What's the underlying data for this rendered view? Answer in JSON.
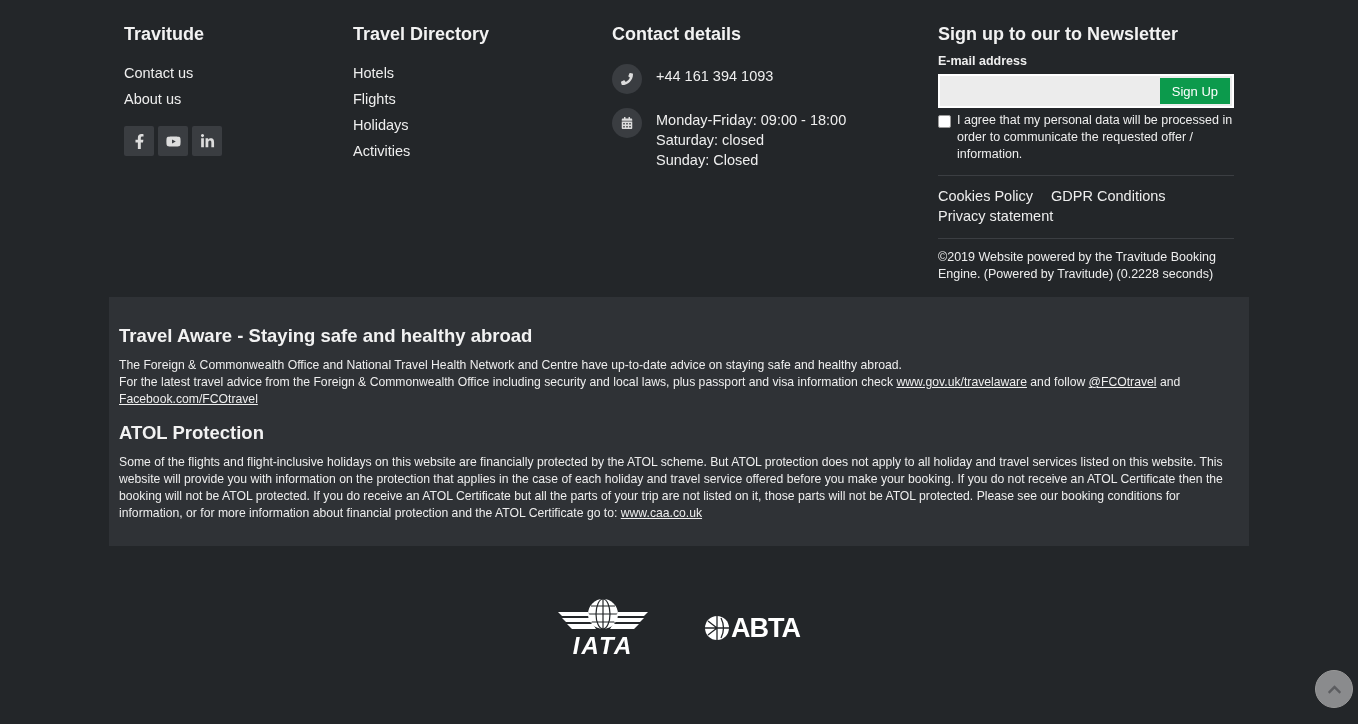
{
  "footer": {
    "columns": [
      {
        "kind": "links",
        "title": "Travitude",
        "links": [
          "Contact us",
          "About us"
        ]
      },
      {
        "kind": "links",
        "title": "Travel Directory",
        "links": [
          "Hotels",
          "Flights",
          "Holidays",
          "Activities"
        ]
      },
      {
        "kind": "contact",
        "title": "Contact details",
        "items": [
          {
            "lines": [
              "+44 161 394 1093"
            ]
          },
          {
            "lines": [
              "Monday-Friday: 09:00 - 18:00",
              "Saturday: closed",
              "Sunday: Closed"
            ]
          }
        ]
      },
      {
        "kind": "newsletter",
        "title": "Sign up to our to Newsletter",
        "email_label": "E-mail address",
        "button": "Sign Up",
        "consent": {
          "label": "I agree that my personal data will be processed in order to communicate the requested offer / information.",
          "checked": false
        },
        "policy_links": [
          "Cookies Policy",
          "GDPR Conditions",
          "Privacy statement"
        ],
        "copyright": "©2019 Website powered by the Travitude Booking Engine. (Powered by Travitude) (0.2228 seconds)"
      }
    ]
  },
  "notice": {
    "sections": [
      {
        "title": "Travel Aware - Staying safe and healthy abroad",
        "paragraphs": [
          [
            {
              "kind": "text",
              "text": "The Foreign & Commonwealth Office and National Travel Health Network and Centre have up-to-date advice on staying safe and healthy abroad."
            }
          ],
          [
            {
              "kind": "text",
              "text": "For the latest travel advice from the Foreign & Commonwealth Office including security and local laws, plus passport and visa information check "
            },
            {
              "kind": "link",
              "text": "www.gov.uk/travelaware"
            },
            {
              "kind": "text",
              "text": " and follow "
            },
            {
              "kind": "link",
              "text": "@FCOtravel"
            },
            {
              "kind": "text",
              "text": " and "
            },
            {
              "kind": "link",
              "text": "Facebook.com/FCOtravel"
            }
          ]
        ]
      },
      {
        "title": "ATOL Protection",
        "paragraphs": [
          [
            {
              "kind": "text",
              "text": "Some of the flights and flight-inclusive holidays on this website are financially protected by the ATOL scheme. But ATOL protection does not apply to all holiday and travel services listed on this website. This website will provide you with information on the protection that applies in the case of each holiday and travel service offered before you make your booking. If you do not receive an ATOL Certificate then the booking will not be ATOL protected. If you do receive an ATOL Certificate but all the parts of your trip are not listed on it, those parts will not be ATOL protected. Please see our booking conditions for information, or for more information about financial protection and the ATOL Certificate go to: "
            },
            {
              "kind": "link",
              "text": "www.caa.co.uk"
            }
          ]
        ]
      }
    ]
  },
  "logos": [
    {
      "kind": "iata",
      "text": "IATA"
    },
    {
      "kind": "abta",
      "text": "ABTA"
    }
  ]
}
